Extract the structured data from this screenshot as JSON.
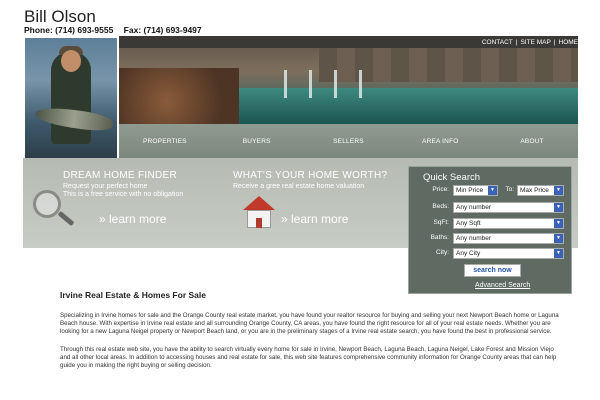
{
  "header": {
    "name": "Bill Olson",
    "phone": "Phone: (714) 693-9555",
    "fax": "Fax: (714) 693-9497"
  },
  "top_links": [
    "CONTACT",
    "SITE MAP",
    "HOME"
  ],
  "nav": {
    "items": [
      "PROPERTIES",
      "BUYERS",
      "SELLERS",
      "AREA INFO",
      "ABOUT"
    ]
  },
  "promo": {
    "dream": {
      "title": "DREAM HOME FINDER",
      "line1": "Request your perfect home",
      "line2": "This is a free service with no obligation",
      "learn": "» learn more"
    },
    "worth": {
      "title": "WHAT'S YOUR HOME WORTH?",
      "line1": "Receive a gree real estate home valuation",
      "learn": "» learn more"
    }
  },
  "quick_search": {
    "title": "Quick Search",
    "price_label": "Price:",
    "min_price": "Min Price",
    "to_label": "To:",
    "max_price": "Max Price",
    "beds_label": "Beds:",
    "beds_value": "Any number",
    "sqft_label": "SqFt:",
    "sqft_value": "Any Sqft",
    "baths_label": "Baths:",
    "baths_value": "Any number",
    "city_label": "City:",
    "city_value": "Any City",
    "search_button": "search now",
    "advanced_link": "Advanced Search"
  },
  "content": {
    "heading": "Irvine Real Estate & Homes For Sale",
    "para1": "Specializing in Irvine homes for sale and the Orange County real estate market, you have found your realtor resource for buying and selling your next Newport Beach home or Laguna Beach house. With expertise in Irvine real estate and all surrounding Orange County, CA areas, you have found the right resource for all of your real estate needs. Whether you are looking for a new Laguna Neigel property or Newport Beach land, or you are in the preliminary stages of a Irvine real estate search, you have found the best in professional service.",
    "para2": "Through this real estate web site, you have the ability to search virtually every home for sale in Irvine, Newport Beach, Laguna Beach, Laguna Neigel, Lake Forest and Mission Viejo and all other local areas. In addition to accessing houses and real estate for sale, this web site features comprehensive community information for Orange County areas that can help guide you in making the right buying or selling decision."
  },
  "icons": [
    "magnifier-icon",
    "house-icon",
    "dropdown-arrow-icon"
  ]
}
